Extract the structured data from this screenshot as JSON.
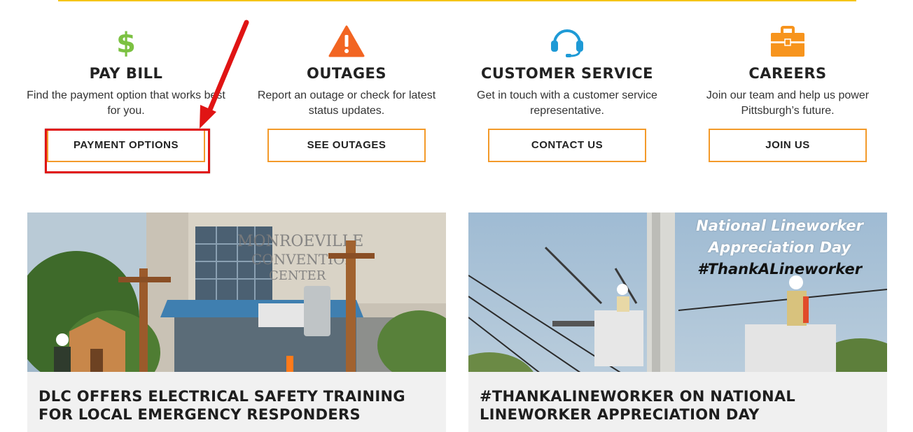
{
  "colors": {
    "accent_orange": "#f39a2a",
    "top_rule_yellow": "#f5c518",
    "dollar_green": "#7cc142",
    "warning_orange": "#f26522",
    "headset_blue": "#1e9ad6",
    "briefcase_orange": "#f7941d",
    "annotation_red": "#e01414"
  },
  "services": [
    {
      "icon": "dollar-sign-icon",
      "title": "PAY BILL",
      "description": "Find the payment option that works best for you.",
      "button": "PAYMENT OPTIONS"
    },
    {
      "icon": "warning-icon",
      "title": "OUTAGES",
      "description": "Report an outage or check for latest status updates.",
      "button": "SEE OUTAGES"
    },
    {
      "icon": "headset-icon",
      "title": "CUSTOMER SERVICE",
      "description": "Get in touch with a customer service representative.",
      "button": "CONTACT US"
    },
    {
      "icon": "briefcase-icon",
      "title": "CAREERS",
      "description": "Join our team and help us power Pittsburgh’s future.",
      "button": "JOIN US"
    }
  ],
  "news": [
    {
      "title": "DLC OFFERS ELECTRICAL SAFETY TRAINING FOR LOCAL EMERGENCY RESPONDERS",
      "image_sign": "MONROEVILLE CONVENTION CENTER"
    },
    {
      "title": "#THANKALINEWORKER ON NATIONAL LINEWORKER APPRECIATION DAY",
      "image_overlay": [
        "National Lineworker",
        "Appreciation Day",
        "#ThankALineworker"
      ]
    }
  ]
}
